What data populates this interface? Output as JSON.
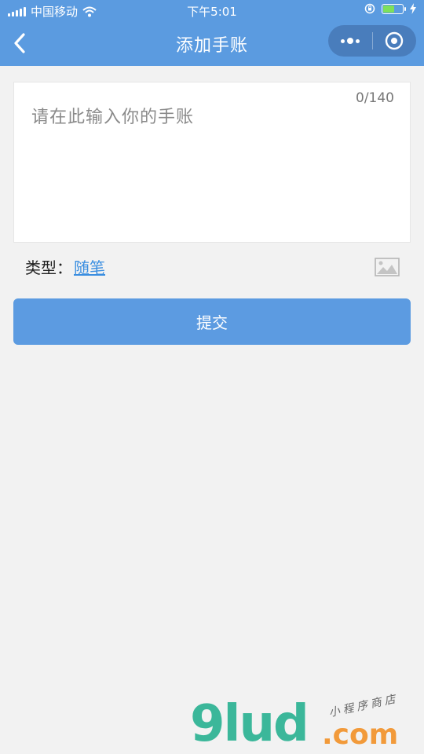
{
  "status_bar": {
    "carrier": "中国移动",
    "time": "下午5:01",
    "battery_level": 0.55,
    "icons": [
      "signal-icon",
      "wifi-icon",
      "rotation-lock-icon",
      "battery-icon",
      "charging-icon"
    ]
  },
  "nav": {
    "title": "添加手账",
    "back_icon": "chevron-left-icon",
    "menu_icon": "more-dots-icon",
    "close_icon": "target-circle-icon"
  },
  "form": {
    "placeholder": "请在此输入你的手账",
    "counter": "0/140",
    "type_label": "类型：",
    "type_value": "随笔",
    "image_icon": "image-icon",
    "submit_label": "提交"
  },
  "watermark": {
    "main": "9lud",
    "com": ".com",
    "sub": "小程序商店"
  },
  "colors": {
    "header": "#5b9be0",
    "button": "#5c9be1",
    "link": "#3a8ee0",
    "background": "#f2f2f2"
  }
}
